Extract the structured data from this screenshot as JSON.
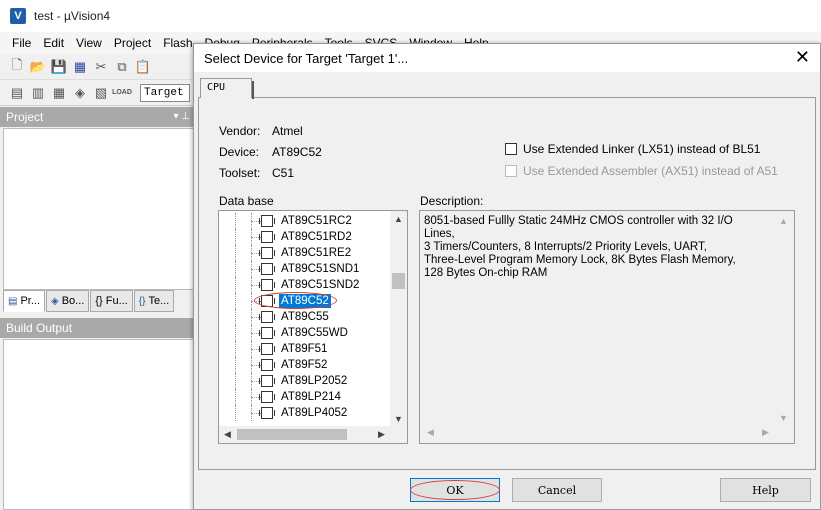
{
  "main_window": {
    "title": "test - µVision4",
    "app_icon": "V",
    "menu": [
      "File",
      "Edit",
      "View",
      "Project",
      "Flash",
      "Debug",
      "Peripherals",
      "Tools",
      "SVCS",
      "Window",
      "Help"
    ],
    "toolbar1_icons": [
      "new-file-icon",
      "open-folder-icon",
      "save-icon",
      "save-all-icon",
      "cut-icon",
      "copy-icon",
      "paste-icon"
    ],
    "toolbar2_icons": [
      "translate-icon",
      "build-icon",
      "rebuild-icon",
      "batch-build-icon",
      "stop-build-icon",
      "load-icon"
    ],
    "load_label": "LOAD",
    "target_combo": "Target",
    "project_panel_title": "Project",
    "project_tabs": [
      {
        "label": "Pr...",
        "icon": "project-icon"
      },
      {
        "label": "Bo...",
        "icon": "books-icon"
      },
      {
        "label": "{} Fu...",
        "icon": "functions-icon"
      },
      {
        "label": "Te...",
        "icon": "templates-icon"
      }
    ],
    "build_output_title": "Build Output"
  },
  "dialog": {
    "title": "Select Device for Target 'Target 1'...",
    "tab_label": "CPU",
    "vendor_label": "Vendor:",
    "vendor_value": "Atmel",
    "device_label": "Device:",
    "device_value": "AT89C52",
    "toolset_label": "Toolset:",
    "toolset_value": "C51",
    "ext_linker_label": "Use Extended Linker (LX51) instead of BL51",
    "ext_assembler_label": "Use Extended Assembler (AX51) instead of A51",
    "database_label": "Data base",
    "description_label": "Description:",
    "devices": [
      "AT89C51RC2",
      "AT89C51RD2",
      "AT89C51RE2",
      "AT89C51SND1",
      "AT89C51SND2",
      "AT89C52",
      "AT89C55",
      "AT89C55WD",
      "AT89F51",
      "AT89F52",
      "AT89LP2052",
      "AT89LP214",
      "AT89LP4052"
    ],
    "selected_device": "AT89C52",
    "description": "8051-based Fullly Static 24MHz CMOS controller with 32  I/O Lines,\n3 Timers/Counters, 8 Interrupts/2 Priority Levels, UART,\nThree-Level Program Memory Lock, 8K Bytes Flash Memory,\n128 Bytes On-chip RAM",
    "ok_label": "OK",
    "cancel_label": "Cancel",
    "help_label": "Help"
  }
}
